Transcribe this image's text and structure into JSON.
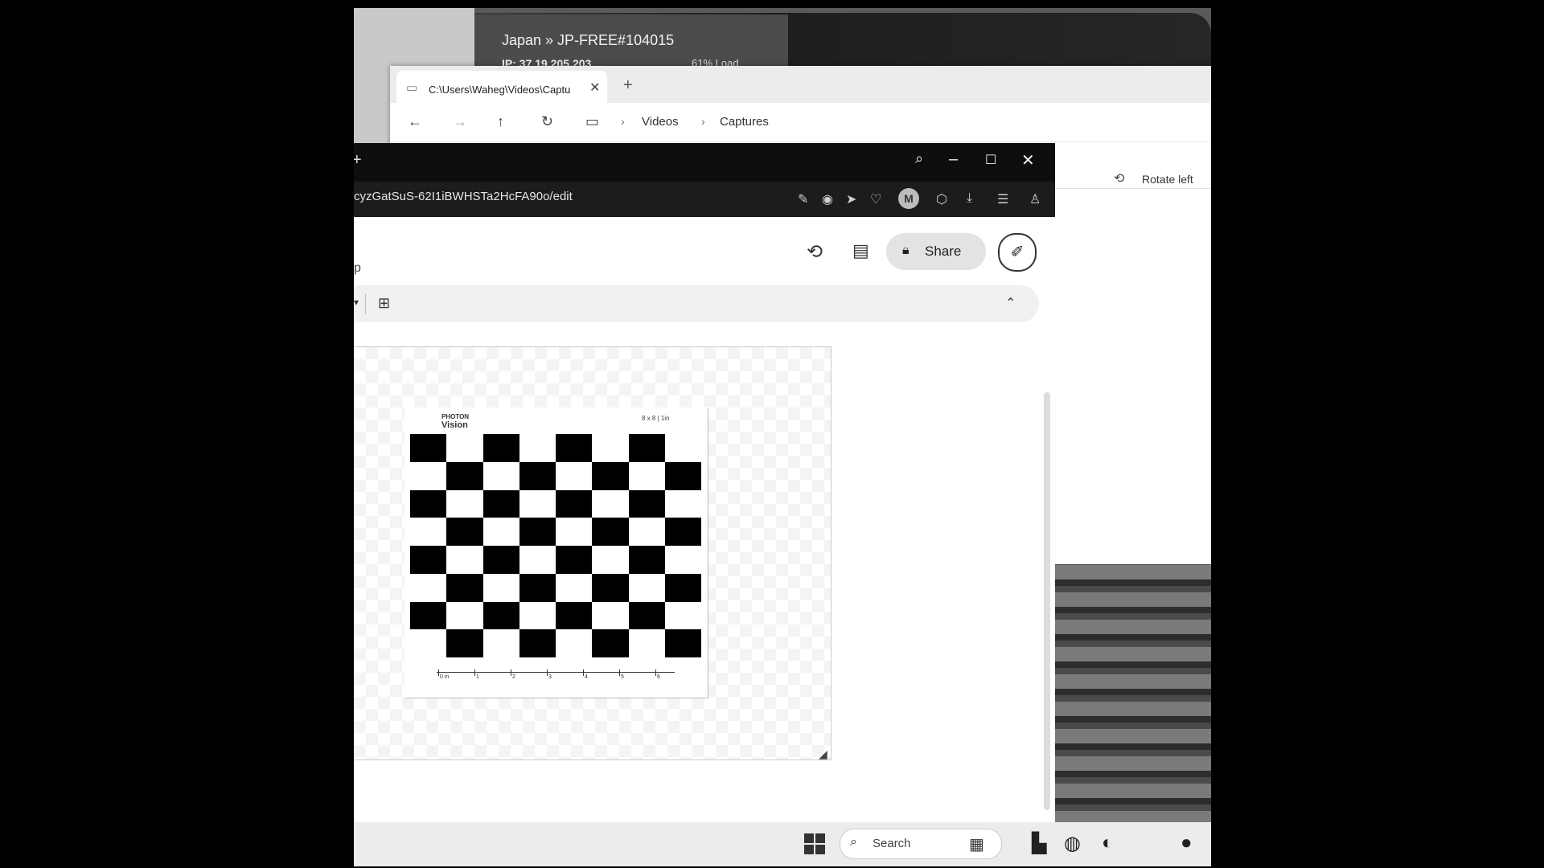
{
  "vpn": {
    "title": "Japan » JP-FREE#104015",
    "ip": "IP: 37.19.205.203",
    "load": "61% Load"
  },
  "explorer": {
    "tab_title": "C:\\Users\\Waheg\\Videos\\Captu",
    "breadcrumb": [
      "Videos",
      "Captures"
    ],
    "rotate_left": "Rotate left"
  },
  "browser": {
    "url": "cyzGatSuS-62I1iBWHSTa2HcFA90o/edit",
    "share_label": "Share",
    "avatar_letter": "M",
    "doc_fragment": "p"
  },
  "drawing": {
    "logo_line1": "PHOTON",
    "logo_line2": "Vision",
    "board_size": "8 x 8 | 1in",
    "ruler_labels": [
      "0 in",
      "1",
      "2",
      "3",
      "4",
      "5",
      "6"
    ],
    "board_rows": 8,
    "board_cols": 8
  },
  "taskbar": {
    "search_placeholder": "Search"
  }
}
